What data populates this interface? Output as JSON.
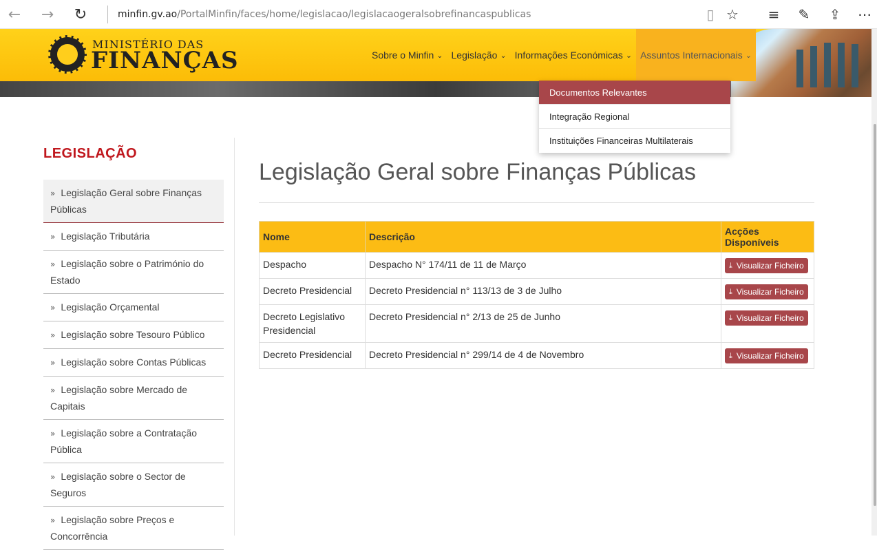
{
  "browser": {
    "url_host": "minfin.gv.ao",
    "url_path": "/PortalMinfin/faces/home/legislacao/legislacaogeralsobrefinancaspublicas",
    "back_icon": "←",
    "forward_icon": "→",
    "refresh_icon": "↻",
    "reading_icon": "▯",
    "favorite_icon": "☆",
    "hub_icon": "≡",
    "note_icon": "✎",
    "share_icon": "⇪",
    "more_icon": "⋯"
  },
  "header": {
    "logo_top": "MINISTÉRIO DAS",
    "logo_bottom": "FINANÇAS",
    "menu": [
      {
        "label": "Sobre o Minfin",
        "chevron": "⌄"
      },
      {
        "label": "Legislação",
        "chevron": "⌄"
      },
      {
        "label": "Informações Económicas",
        "chevron": "⌄"
      },
      {
        "label": "Assuntos Internacionais",
        "chevron": "⌄"
      }
    ]
  },
  "dropdown": {
    "items": [
      {
        "label": "Documentos Relevantes"
      },
      {
        "label": "Integração Regional"
      },
      {
        "label": "Instituições Financeiras Multilaterais"
      }
    ]
  },
  "sidebar": {
    "title": "LEGISLAÇÃO",
    "arrow": "»",
    "items": [
      {
        "label": "Legislação Geral sobre Finanças Públicas"
      },
      {
        "label": "Legislação Tributária"
      },
      {
        "label": "Legislação sobre o Património do Estado"
      },
      {
        "label": "Legislação Orçamental"
      },
      {
        "label": "Legislação sobre Tesouro Público"
      },
      {
        "label": "Legislação sobre Contas Públicas"
      },
      {
        "label": "Legislação sobre Mercado de Capitais"
      },
      {
        "label": "Legislação sobre a Contratação Pública"
      },
      {
        "label": "Legislação sobre o Sector de Seguros"
      },
      {
        "label": "Legislação sobre Preços e Concorrência"
      }
    ]
  },
  "main": {
    "title": "Legislação Geral sobre Finanças Públicas",
    "table": {
      "headers": [
        "Nome",
        "Descrição",
        "Acções Disponíveis"
      ],
      "download_icon": "⤓",
      "rows": [
        {
          "nome": "Despacho",
          "descricao": "Despacho N° 174/11 de 11 de Março",
          "acao": "Visualizar Ficheiro"
        },
        {
          "nome": "Decreto Presidencial",
          "descricao": "Decreto Presidencial n° 113/13 de 3 de Julho",
          "acao": "Visualizar Ficheiro"
        },
        {
          "nome": "Decreto Legislativo Presidencial",
          "descricao": "Decreto Presidencial n° 2/13 de 25 de Junho",
          "acao": "Visualizar Ficheiro"
        },
        {
          "nome": "Decreto Presidencial",
          "descricao": "Decreto Presidencial n° 299/14 de 4 de Novembro",
          "acao": "Visualizar Ficheiro"
        }
      ]
    }
  },
  "colors": {
    "header_yellow": "#fcbc07",
    "accent_red": "#c0171d",
    "button_red": "#a8464a"
  }
}
